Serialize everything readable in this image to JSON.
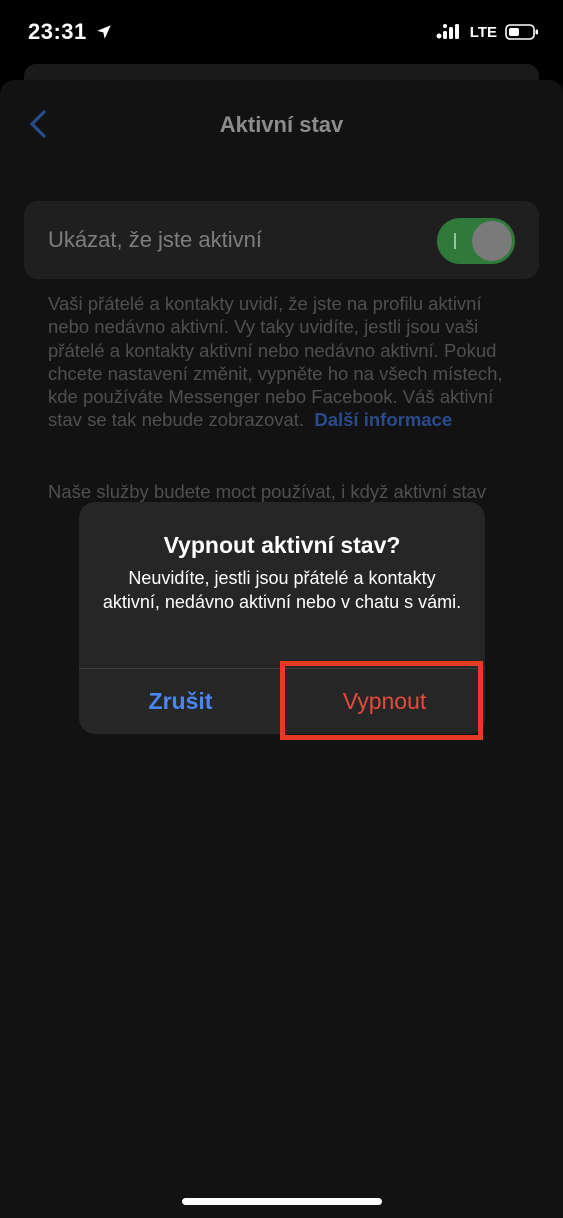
{
  "status_bar": {
    "time": "23:31",
    "network": "LTE",
    "icons": [
      "location-arrow-icon",
      "signal-icon",
      "battery-icon"
    ]
  },
  "nav": {
    "title": "Aktivní stav",
    "back_icon": "chevron-left-icon"
  },
  "setting": {
    "label": "Ukázat, že jste aktivní",
    "toggle_on": true
  },
  "description": {
    "text": "Vaši přátelé a kontakty uvidí, že jste na profilu aktivní nebo nedávno aktivní. Vy taky uvidíte, jestli jsou vaši přátelé a kontakty aktivní nebo nedávno aktivní. Pokud chcete nastavení změnit, vypněte ho na všech místech, kde používáte Messenger nebo Facebook. Váš aktivní stav se tak nebude zobrazovat.",
    "link": "Další informace",
    "text2": "Naše služby budete moct používat, i když aktivní stav"
  },
  "alert": {
    "title": "Vypnout aktivní stav?",
    "message": "Neuvidíte, jestli jsou přátelé a kontakty aktivní, nedávno aktivní nebo v chatu s vámi.",
    "cancel_label": "Zrušit",
    "confirm_label": "Vypnout"
  },
  "colors": {
    "accent_blue": "#4a86f0",
    "destructive_red": "#e54a3c",
    "toggle_green": "#2f7a3b",
    "highlight_red": "#e53a24"
  }
}
